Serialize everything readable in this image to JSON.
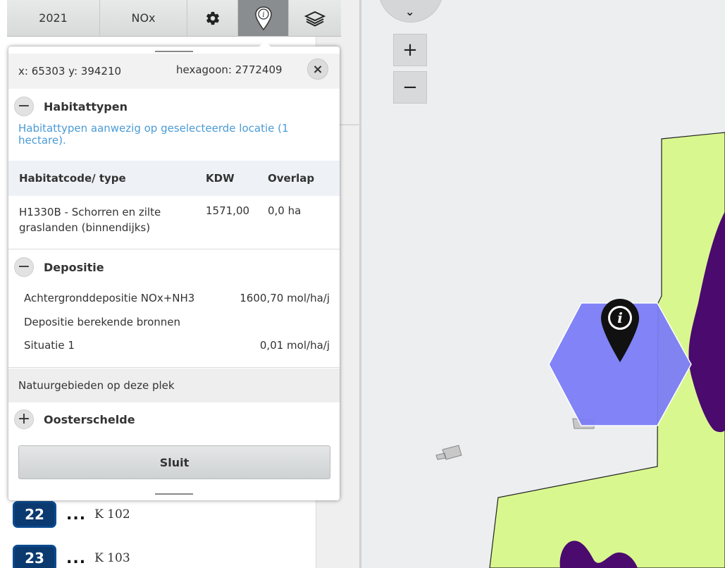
{
  "toolbar": {
    "year": "2021",
    "substance": "NOx",
    "settings_icon": "gear-icon",
    "info_icon": "info-marker-icon",
    "layers_icon": "layers-icon"
  },
  "popup": {
    "coords": "x: 65303 y: 394210",
    "hexagon": "hexagoon: 2772409",
    "close_icon": "×",
    "habitat": {
      "toggle": "−",
      "title": "Habitattypen",
      "description": "Habitattypen aanwezig op geselecteerde locatie (1 hectare).",
      "columns": [
        "Habitatcode/ type",
        "KDW",
        "Overlap"
      ],
      "rows": [
        {
          "code": "H1330B - Schorren en zilte graslanden (binnendijks)",
          "kdw": "1571,00",
          "overlap": "0,0 ha"
        }
      ]
    },
    "depositie": {
      "toggle": "−",
      "title": "Depositie",
      "background_label": "Achtergronddepositie NOx+NH3",
      "background_value": "1600,70 mol/ha/j",
      "calculated_label": "Depositie berekende bronnen",
      "situation_label": "Situatie 1",
      "situation_value": "0,01 mol/ha/j"
    },
    "nature_header": "Natuurgebieden op deze plek",
    "oosterschelde": {
      "toggle": "+",
      "title": "Oosterschelde"
    },
    "close_button": "Sluit"
  },
  "list": [
    {
      "number": "22",
      "dots": "...",
      "label": "K 102"
    },
    {
      "number": "23",
      "dots": "...",
      "label": "K 103"
    }
  ],
  "map": {
    "zoom_in": "+",
    "zoom_out": "−",
    "compass_arrow": "⌄",
    "colors": {
      "background": "#eceef0",
      "habitat_area": "#d9f78f",
      "habitat_dark": "#4a0a6e",
      "hexagon": "#7b7cf5"
    }
  }
}
